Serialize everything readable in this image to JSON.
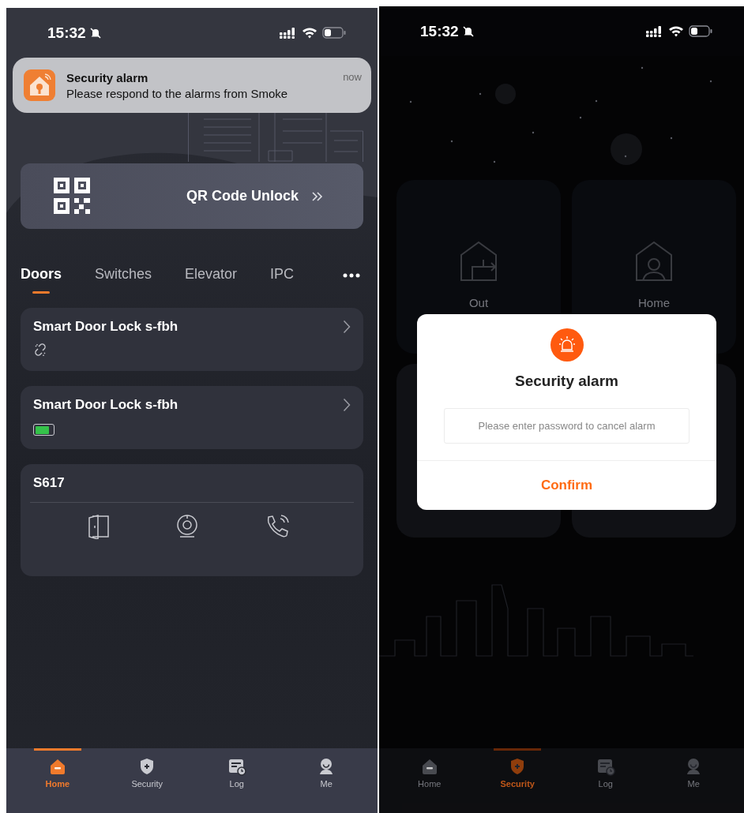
{
  "home_screen": {
    "status_bar": {
      "time": "15:32"
    },
    "notification": {
      "title": "Security alarm",
      "message": "Please respond to the alarms from Smoke",
      "time": "now"
    },
    "qr_unlock": {
      "label": "QR Code Unlock"
    },
    "tabs": [
      {
        "label": "Doors",
        "selected": true
      },
      {
        "label": "Switches",
        "selected": false
      },
      {
        "label": "Elevator",
        "selected": false
      },
      {
        "label": "IPC",
        "selected": false
      }
    ],
    "devices": [
      {
        "kind": "lock",
        "name": "Smart Door Lock s-fbh",
        "offline": true
      },
      {
        "kind": "lock",
        "name": "Smart Door Lock s-fbh",
        "offline": false,
        "level": 0.8
      },
      {
        "kind": "intercom",
        "name": "S617"
      }
    ],
    "nav": [
      {
        "kind": "home",
        "label": "Home",
        "selected": true
      },
      {
        "kind": "security",
        "label": "Security",
        "selected": false
      },
      {
        "kind": "log",
        "label": "Log",
        "selected": false
      },
      {
        "kind": "me",
        "label": "Me",
        "selected": false
      }
    ]
  },
  "security_screen": {
    "status_bar": {
      "time": "15:32"
    },
    "modes": [
      {
        "kind": "out",
        "label": "Out"
      },
      {
        "kind": "home",
        "label": "Home"
      }
    ],
    "dialog": {
      "title": "Security alarm",
      "placeholder": "Please enter password to cancel alarm",
      "confirm": "Confirm"
    },
    "nav": [
      {
        "kind": "home",
        "label": "Home",
        "selected": false
      },
      {
        "kind": "security",
        "label": "Security",
        "selected": true
      },
      {
        "kind": "log",
        "label": "Log",
        "selected": false
      },
      {
        "kind": "me",
        "label": "Me",
        "selected": false
      }
    ]
  }
}
